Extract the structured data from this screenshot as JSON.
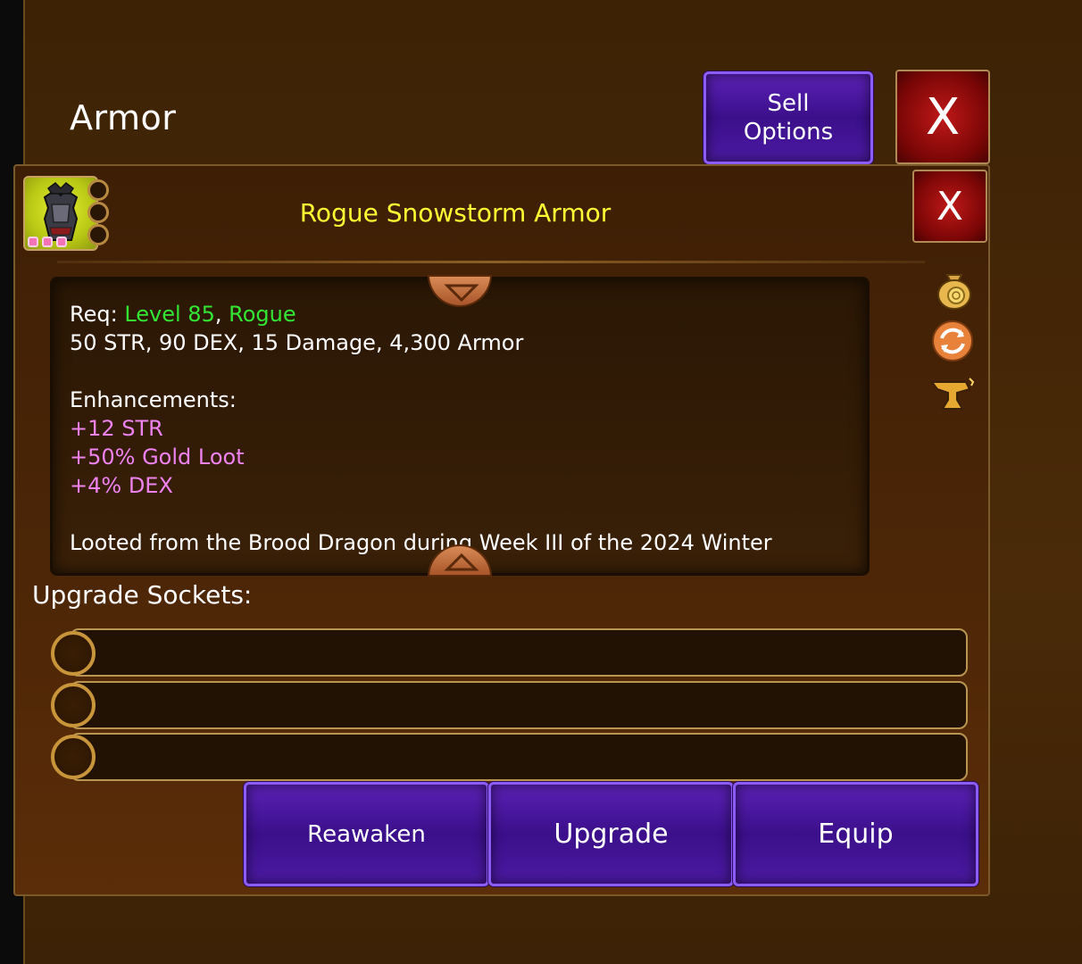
{
  "header": {
    "title": "Armor",
    "sell_button_label": "Sell\nOptions",
    "close_label": "X"
  },
  "item": {
    "name": "Rogue Snowstorm Armor",
    "close_label": "X",
    "req_prefix": "Req: ",
    "req_level": "Level 85",
    "req_separator": ", ",
    "req_class": "Rogue",
    "stats": "50 STR, 90 DEX, 15 Damage, 4,300 Armor",
    "enhancements_title": "Enhancements:",
    "enhancements": [
      "+12 STR",
      "+50% Gold Loot",
      "+4% DEX"
    ],
    "lore": "Looted from the Brood Dragon during Week III of the 2024 Winter"
  },
  "side_icons": [
    "gold-bag-icon",
    "recycle-icon",
    "anvil-icon"
  ],
  "sockets": {
    "title": "Upgrade Sockets:",
    "count": 3
  },
  "actions": {
    "reawaken": "Reawaken",
    "upgrade": "Upgrade",
    "equip": "Equip"
  },
  "colors": {
    "requirement_green": "#33e633",
    "enhancement_pink": "#ee82ee",
    "item_name_yellow": "#ffff33",
    "button_purple": "#4c1aa3"
  }
}
